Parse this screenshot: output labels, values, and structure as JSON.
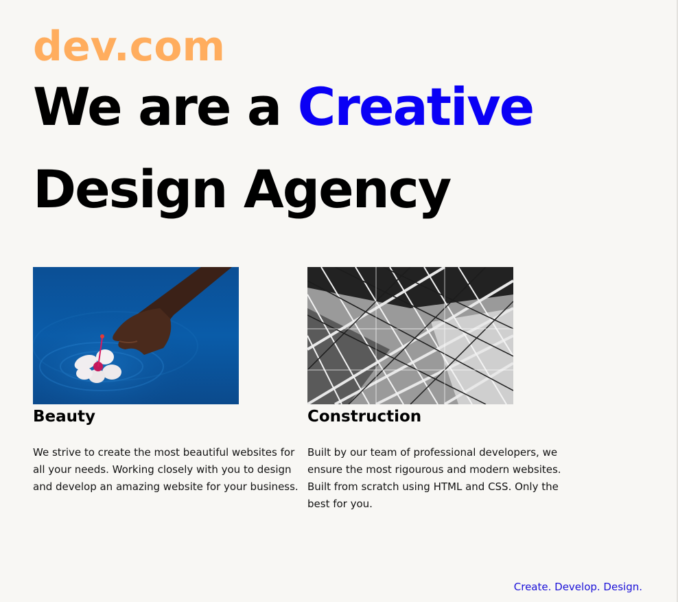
{
  "brand": {
    "logo_text": "dev.com",
    "logo_color": "#ffad5e"
  },
  "hero": {
    "line1_prefix": "We are a ",
    "line1_highlight": "Creative",
    "line2": "Design Agency",
    "highlight_color": "#0a00f5"
  },
  "services": [
    {
      "title": "Beauty",
      "image_icon": "hand-flower-water-photo",
      "description": "We strive to create the most beautiful websites for all your needs. Working closely with you to design and develop an amazing website for your business."
    },
    {
      "title": "Construction",
      "image_icon": "steel-structure-photo",
      "description": "Built by our team of professional developers, we ensure the most rigourous and modern websites. Built from scratch using HTML and CSS. Only the best for you."
    }
  ],
  "footer": {
    "tagline": "Create. Develop. Design.",
    "tagline_color": "#1a10d8"
  }
}
